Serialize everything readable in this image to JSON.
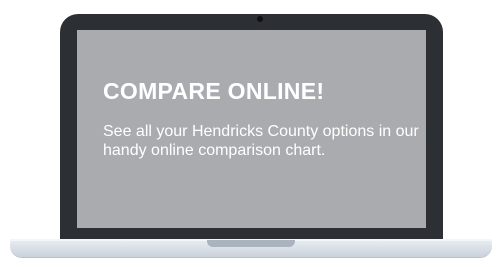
{
  "headline": "COMPARE ONLINE!",
  "body": "See all your Hendricks County options in our handy online comparison chart.",
  "colors": {
    "bezel": "#2c2f33",
    "screen": "#a9abae",
    "text": "#ffffff",
    "base": "#d5dce4"
  }
}
